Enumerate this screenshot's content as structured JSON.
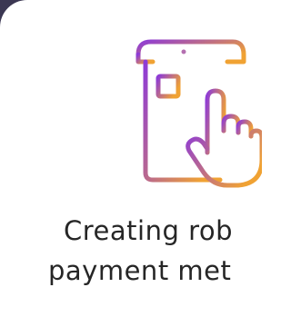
{
  "feature": {
    "icon_name": "document-click-icon",
    "caption_line1": "Creating rob",
    "caption_line2": "payment met"
  },
  "colors": {
    "background": "#3b3752",
    "card": "#ffffff",
    "gradient_start": "#8e3bd6",
    "gradient_end": "#f0a233",
    "text": "#262626"
  }
}
